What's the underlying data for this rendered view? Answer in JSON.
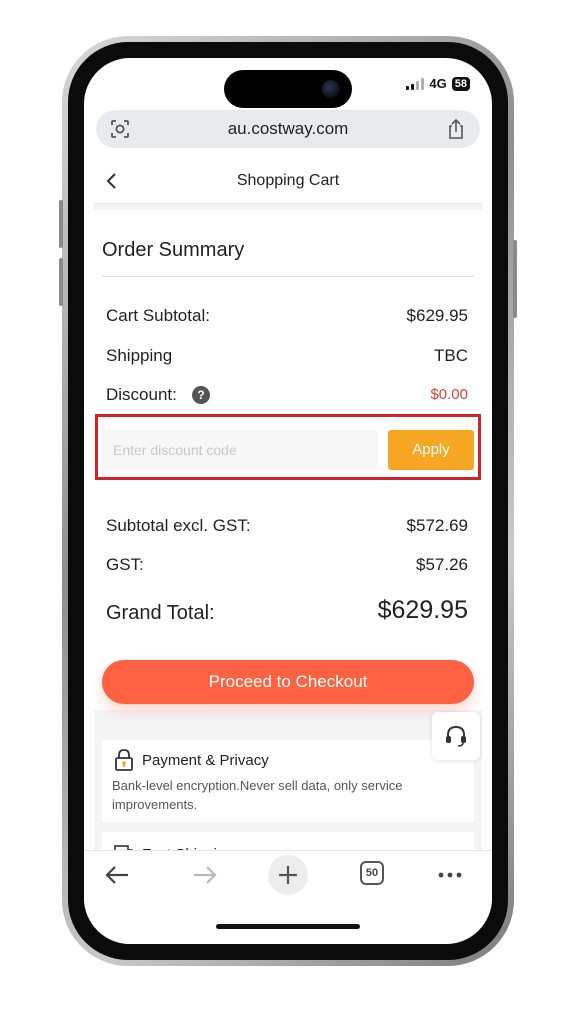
{
  "status_bar": {
    "network": "4G",
    "battery": "58"
  },
  "browser": {
    "url": "au.costway.com",
    "tabs_count": "50"
  },
  "header": {
    "title": "Shopping Cart"
  },
  "summary": {
    "title": "Order Summary",
    "rows": [
      {
        "label": "Cart Subtotal:",
        "value": "$629.95"
      },
      {
        "label": "Shipping",
        "value": "TBC"
      },
      {
        "label": "Discount:",
        "value": "$0.00"
      },
      {
        "label": "Subtotal excl. GST:",
        "value": "$572.69"
      },
      {
        "label": "GST:",
        "value": "$57.26"
      }
    ],
    "discount_placeholder": "Enter discount code",
    "apply_label": "Apply",
    "grand_total_label": "Grand Total:",
    "grand_total_value": "$629.95",
    "checkout_label": "Proceed to Checkout"
  },
  "info_cards": [
    {
      "title": "Payment & Privacy",
      "description": "Bank-level encryption.Never sell data, only service improvements."
    },
    {
      "title": "Fast Shipping",
      "description": ""
    }
  ],
  "colors": {
    "accent_checkout": "#ff6242",
    "apply_button": "#f6a623",
    "discount_value": "#d6453a",
    "highlight_border": "#d0222f"
  },
  "icons": {
    "url_left": "lens-icon",
    "url_right": "share-icon",
    "back": "chevron-left-icon",
    "help": "question-icon",
    "support": "headset-icon",
    "lock": "lock-icon",
    "shipping": "truck-icon",
    "toolbar": [
      "back-arrow-icon",
      "forward-arrow-icon",
      "plus-icon",
      "tabs-icon",
      "more-icon"
    ]
  }
}
